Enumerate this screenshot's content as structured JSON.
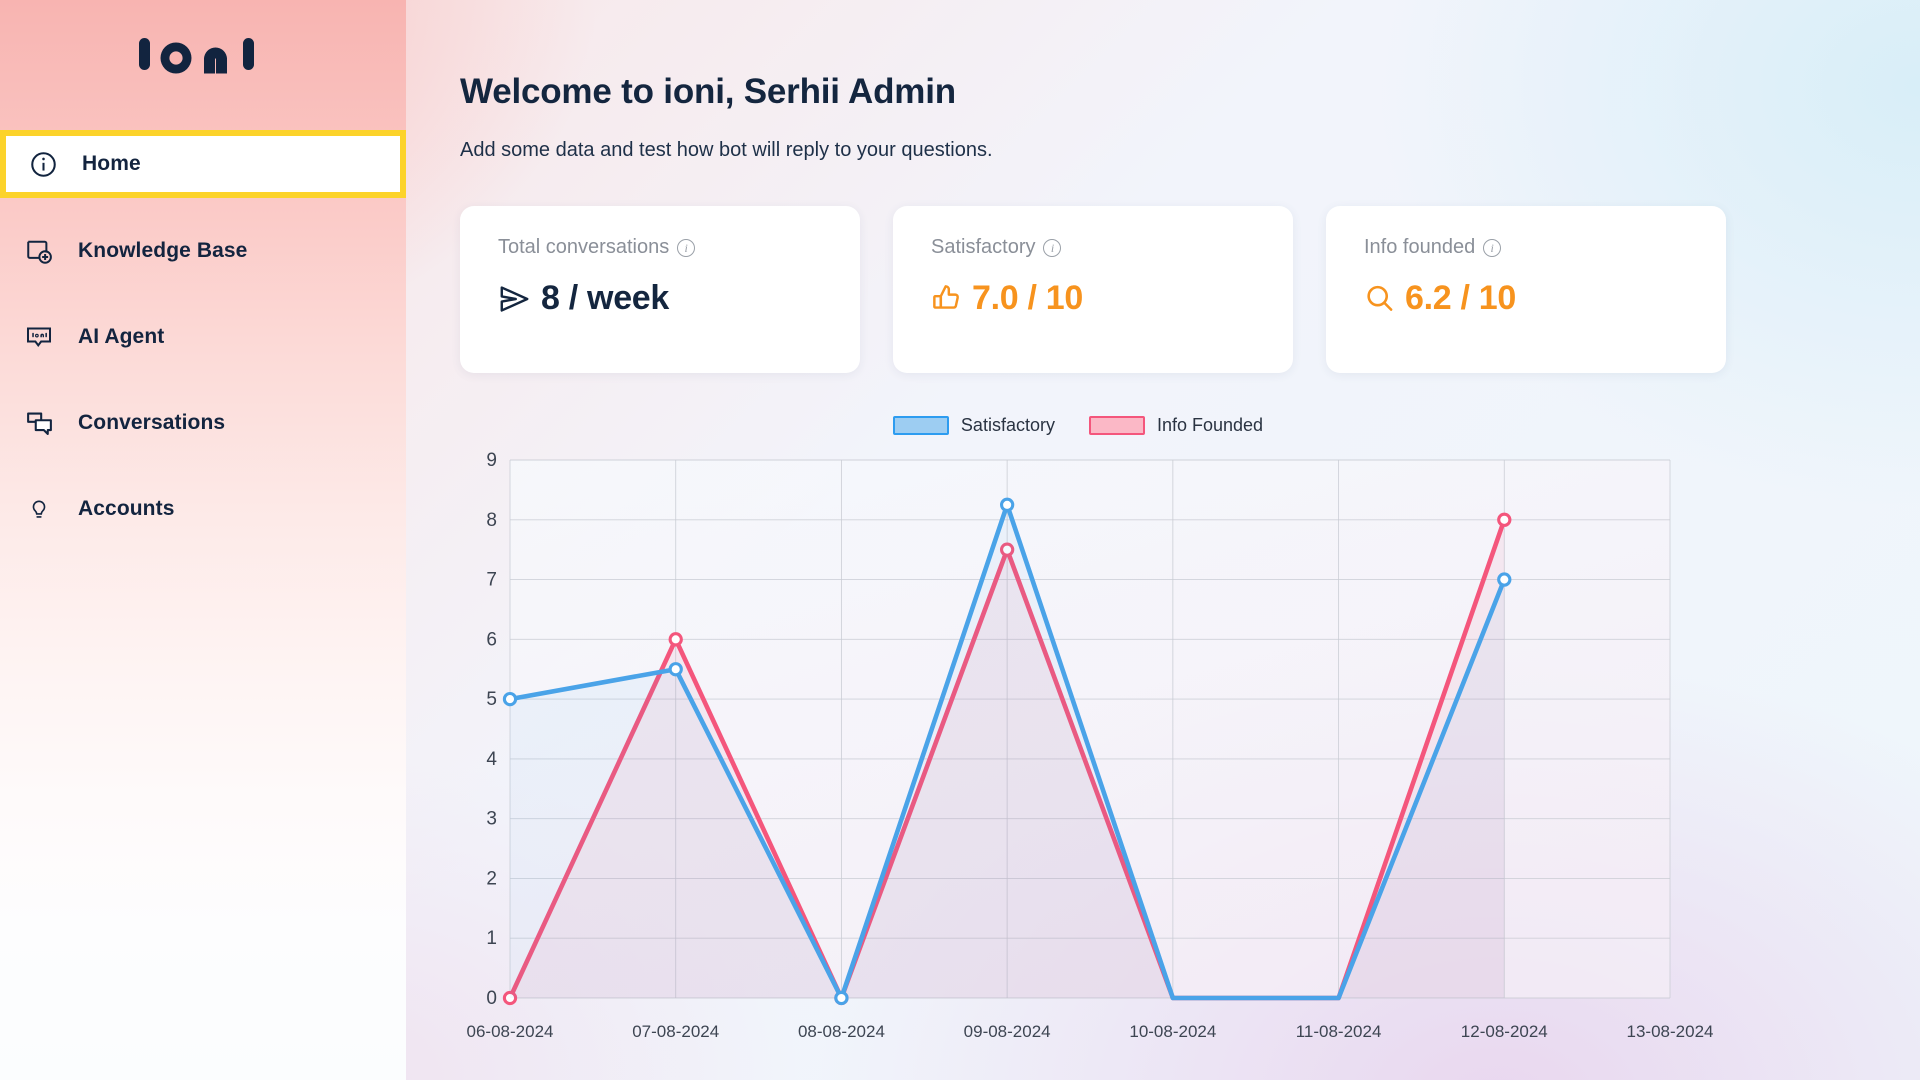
{
  "brand": {
    "logo_text": "ioni"
  },
  "sidebar": {
    "items": [
      {
        "label": "Home",
        "icon": "info-circle-icon",
        "active": true
      },
      {
        "label": "Knowledge Base",
        "icon": "file-plus-icon",
        "active": false
      },
      {
        "label": "AI Agent",
        "icon": "chat-bubble-ioni-icon",
        "active": false
      },
      {
        "label": "Conversations",
        "icon": "conversations-icon",
        "active": false
      },
      {
        "label": "Accounts",
        "icon": "lightbulb-icon",
        "active": false
      }
    ],
    "active_outline_color": "#fcd32a"
  },
  "header": {
    "title": "Welcome to ioni, Serhii Admin",
    "subtitle": "Add some data and test how bot will reply to your questions."
  },
  "cards": [
    {
      "label": "Total conversations",
      "icon": "send-icon",
      "value": "8 / week",
      "value_color": "#14263f"
    },
    {
      "label": "Satisfactory",
      "icon": "thumbs-up-icon",
      "value": "7.0 / 10",
      "value_color": "#f7931e"
    },
    {
      "label": "Info founded",
      "icon": "search-icon",
      "value": "6.2 / 10",
      "value_color": "#f7931e"
    }
  ],
  "chart_data": {
    "type": "line",
    "title": "",
    "xlabel": "",
    "ylabel": "",
    "grid": true,
    "legend_position": "top-center",
    "categories": [
      "06-08-2024",
      "07-08-2024",
      "08-08-2024",
      "09-08-2024",
      "10-08-2024",
      "11-08-2024",
      "12-08-2024",
      "13-08-2024"
    ],
    "ylim": [
      0,
      9
    ],
    "yticks": [
      0,
      1,
      2,
      3,
      4,
      5,
      6,
      7,
      8,
      9
    ],
    "series": [
      {
        "name": "Satisfactory",
        "color": "#4aa3e8",
        "fill": "rgba(74,163,232,0.06)",
        "values": [
          5,
          5.5,
          0,
          8.25,
          0,
          0,
          7,
          null
        ]
      },
      {
        "name": "Info Founded",
        "color": "#f4567c",
        "fill": "rgba(244,86,124,0.08)",
        "values": [
          0,
          6,
          0,
          7.5,
          0,
          0,
          8,
          null
        ]
      }
    ]
  }
}
